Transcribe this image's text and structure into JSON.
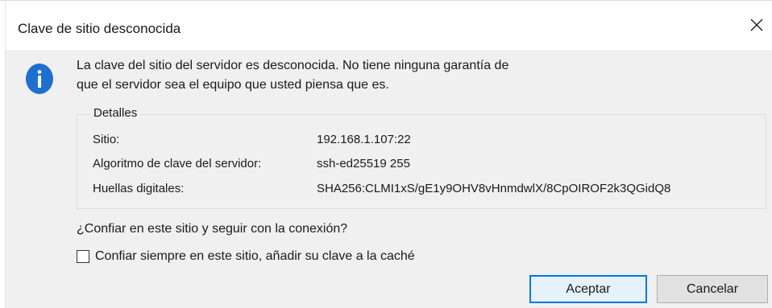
{
  "window": {
    "title": "Clave de sitio desconocida",
    "close_icon": "close-icon"
  },
  "icon": {
    "name": "info-icon",
    "color": "#1e6fd0"
  },
  "message": {
    "line1": "La clave del sitio del servidor es desconocida. No tiene ninguna garantía de",
    "line2": "que el servidor sea el equipo que usted piensa que es."
  },
  "details": {
    "legend": "Detalles",
    "rows": [
      {
        "label": "Sitio:",
        "value": "192.168.1.107:22"
      },
      {
        "label": "Algoritmo de clave del servidor:",
        "value": "ssh-ed25519 255"
      },
      {
        "label": "Huellas digitales:",
        "value": "SHA256:CLMI1xS/gE1y9OHV8vHnmdwlX/8CpOIROF2k3QGidQ8"
      }
    ]
  },
  "question": "¿Confiar en este sitio y seguir con la conexión?",
  "checkbox": {
    "label": "Confiar siempre en este sitio, añadir su clave a la caché",
    "checked": false
  },
  "buttons": {
    "accept": "Aceptar",
    "cancel": "Cancelar"
  },
  "colors": {
    "accent": "#0078d7",
    "dialog_body": "#f0f0f0"
  }
}
